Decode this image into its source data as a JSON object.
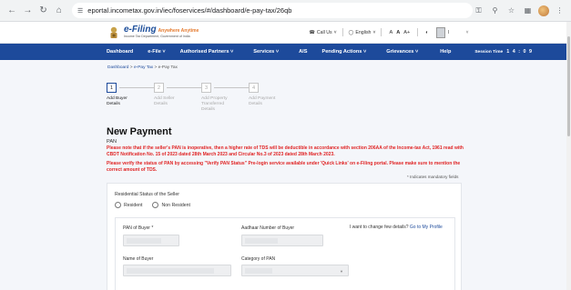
{
  "browser": {
    "url": "eportal.incometax.gov.in/iec/foservices/#/dashboard/e-pay-tax/26qb",
    "icons": [
      "back-icon",
      "forward-icon",
      "reload-icon",
      "home-icon",
      "site-info-icon",
      "key-icon",
      "zoom-icon",
      "star-icon",
      "extensions-icon",
      "profile-icon",
      "menu-icon"
    ]
  },
  "header": {
    "logo_title": "e-Filing",
    "logo_tagline": "Anywhere Anytime",
    "logo_sub": "Income Tax Department, Government of India",
    "call_us": "Call Us",
    "language": "English",
    "font_small": "A",
    "font_large": "A+",
    "font_default": "A",
    "user_initial": "I"
  },
  "nav": {
    "items": [
      "Dashboard",
      "e-File",
      "Authorised Partners",
      "Services",
      "AIS",
      "Pending Actions",
      "Grievances",
      "Help"
    ],
    "session_label": "Session Time",
    "session_value": "1 4 : 0 9"
  },
  "breadcrumb": {
    "items": [
      "Dashboard",
      "e-Pay Tax",
      "e-Pay Tax"
    ]
  },
  "stepper": {
    "steps": [
      {
        "num": "1",
        "label": "Add Buyer Details"
      },
      {
        "num": "2",
        "label": "Add Seller Details"
      },
      {
        "num": "3",
        "label": "Add Property Transferred Details"
      },
      {
        "num": "4",
        "label": "Add Payment Details"
      }
    ]
  },
  "main": {
    "title": "New Payment",
    "pan_label": "PAN",
    "warning_1": "Please note that if the seller's PAN is inoperative, then a higher rate of TDS will be deductible in accordance with section 206AA of the Income-tax Act, 1961 read with CBDT Notification No. 15 of 2023 dated 28th March 2023 and Circular No.3 of 2023 dated 28th March 2023.",
    "warning_2": "Please verify the status of PAN by accessing \"Verify PAN Status\" Pre-login service available under 'Quick Links' on e-Filing portal. Please make sure to mention the correct amount of TDS.",
    "mandatory_note": "* Indicates mandatory fields"
  },
  "form": {
    "residential_label": "Residential Status of the Seller",
    "options": [
      "Resident",
      "Non Resident"
    ],
    "pan_buyer_label": "PAN of Buyer",
    "pan_buyer_req": "*",
    "aadhaar_label": "Aadhaar Number of Buyer",
    "change_text": "I want to change few details?",
    "change_link": "Go to My Profile",
    "name_label": "Name of Buyer",
    "category_label": "Category of PAN"
  },
  "colors": {
    "nav": "#1d4a9b",
    "warning": "#e02424",
    "link": "#1d4a9b"
  }
}
